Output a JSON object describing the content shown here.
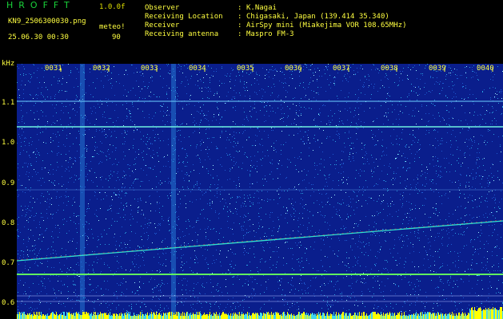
{
  "header": {
    "title": "HROFFT",
    "version": "1.0.0f",
    "filename": "KN9_2506300030.png",
    "source": "meteo!",
    "datetime": "25.06.30 00:30",
    "value": "90"
  },
  "info": [
    {
      "label": "Observer",
      "value": "K.Nagai"
    },
    {
      "label": "Receiving Location",
      "value": "Chigasaki, Japan (139.414 35.340)"
    },
    {
      "label": "Receiver",
      "value": "AirSpy mini (Miakejima VOR 108.65MHz)"
    },
    {
      "label": "Receiving antenna",
      "value": "Maspro FM-3"
    }
  ],
  "chart_data": {
    "type": "heatmap",
    "ylabel": "kHz",
    "y_ticks": [
      "1.1",
      "1.0",
      "0.9",
      "0.8",
      "0.7",
      "0.6"
    ],
    "x_ticks": [
      "0031",
      "0032",
      "0033",
      "0034",
      "0035",
      "0036",
      "0037",
      "0038",
      "0039",
      "0040"
    ],
    "colors": {
      "background": "#0a1e8c",
      "noise": "#2aa0e0",
      "line": "#40e8d0",
      "bottom_bar": "#ffff00"
    }
  }
}
